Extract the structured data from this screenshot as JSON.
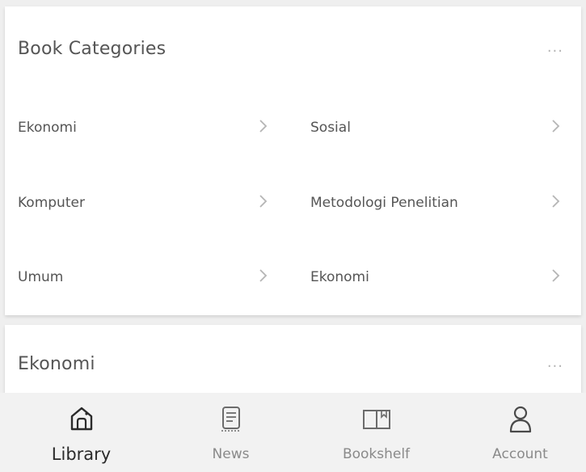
{
  "categories_card": {
    "title": "Book Categories",
    "more_label": "...",
    "items": [
      {
        "label": "Ekonomi"
      },
      {
        "label": "Sosial"
      },
      {
        "label": "Komputer"
      },
      {
        "label": "Metodologi Penelitian"
      },
      {
        "label": "Umum"
      },
      {
        "label": "Ekonomi"
      }
    ]
  },
  "section_card": {
    "title": "Ekonomi",
    "more_label": "..."
  },
  "bottom_nav": {
    "active_index": 0,
    "items": [
      {
        "label": "Library",
        "icon": "home-icon"
      },
      {
        "label": "News",
        "icon": "news-icon"
      },
      {
        "label": "Bookshelf",
        "icon": "book-icon"
      },
      {
        "label": "Account",
        "icon": "user-icon"
      }
    ]
  },
  "colors": {
    "background": "#efefef",
    "card": "#ffffff",
    "text": "#555555",
    "chevron": "#b5b5b5",
    "nav_active": "#2b2b2b",
    "nav_inactive": "#8a8a8a"
  }
}
